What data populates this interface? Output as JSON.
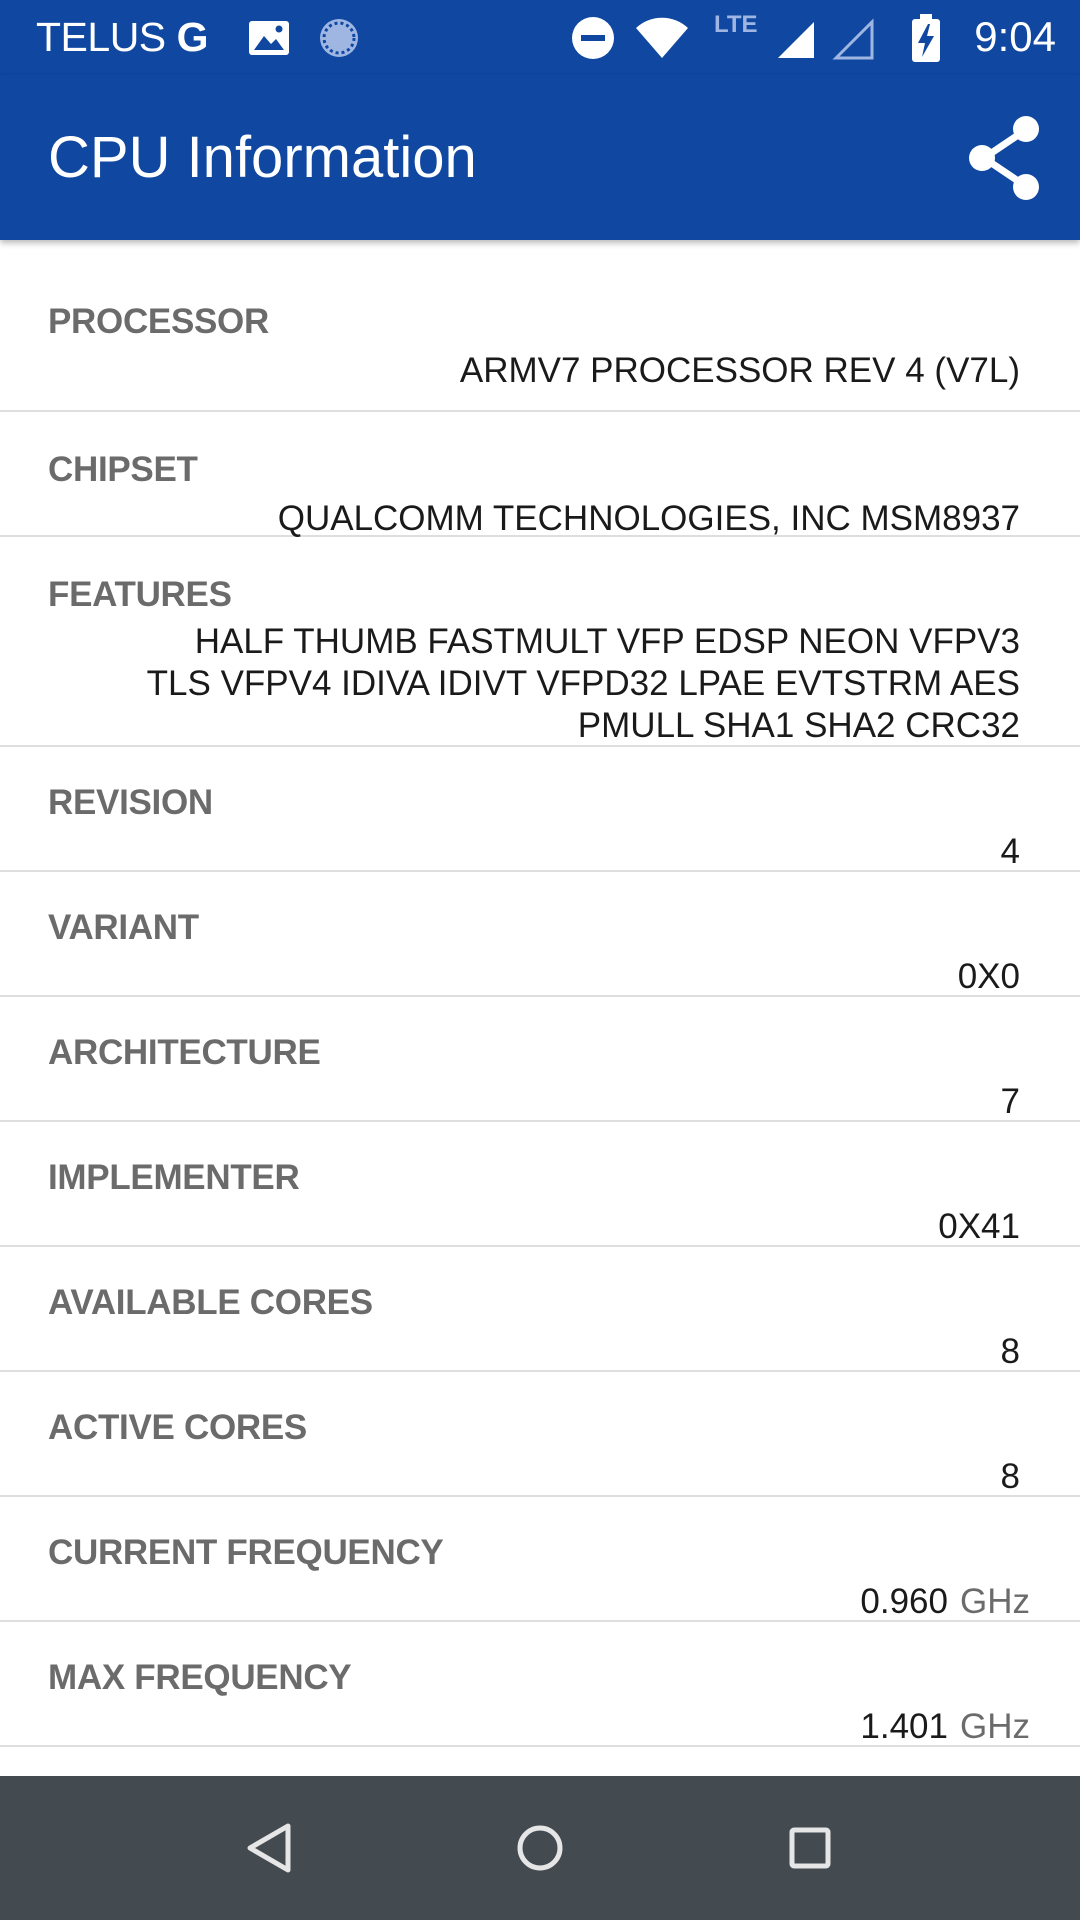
{
  "status_bar": {
    "carrier": "TELUS",
    "network_letter": "G",
    "network_type": "LTE",
    "time": "9:04",
    "icons": [
      "image-icon",
      "sync-icon",
      "do-not-disturb-icon",
      "wifi-icon",
      "signal-icon",
      "signal-empty-icon",
      "battery-charging-icon"
    ]
  },
  "app_bar": {
    "title": "CPU Information",
    "share_icon": "share-icon"
  },
  "rows": [
    {
      "label": "PROCESSOR",
      "value": "ARMV7 PROCESSOR REV 4 (V7L)"
    },
    {
      "label": "CHIPSET",
      "value": "QUALCOMM TECHNOLOGIES, INC MSM8937"
    },
    {
      "label": "FEATURES",
      "value": "HALF THUMB FASTMULT VFP EDSP NEON VFPV3 TLS VFPV4 IDIVA IDIVT VFPD32 LPAE EVTSTRM AES PMULL SHA1 SHA2 CRC32"
    },
    {
      "label": "REVISION",
      "value": "4"
    },
    {
      "label": "VARIANT",
      "value": "0X0"
    },
    {
      "label": "ARCHITECTURE",
      "value": "7"
    },
    {
      "label": "IMPLEMENTER",
      "value": "0X41"
    },
    {
      "label": "AVAILABLE CORES",
      "value": "8"
    },
    {
      "label": "ACTIVE CORES",
      "value": "8"
    },
    {
      "label": "CURRENT FREQUENCY",
      "value": "0.960",
      "unit": "GHz"
    },
    {
      "label": "MAX FREQUENCY",
      "value": "1.401",
      "unit": "GHz"
    }
  ],
  "nav_bar": {
    "buttons": [
      "back-icon",
      "home-icon",
      "recents-icon"
    ]
  },
  "colors": {
    "primary": "#0f47a1",
    "nav_bar": "#434a50",
    "label": "#6b6b6b",
    "value": "#1a1a1a",
    "divider": "#dedede"
  }
}
